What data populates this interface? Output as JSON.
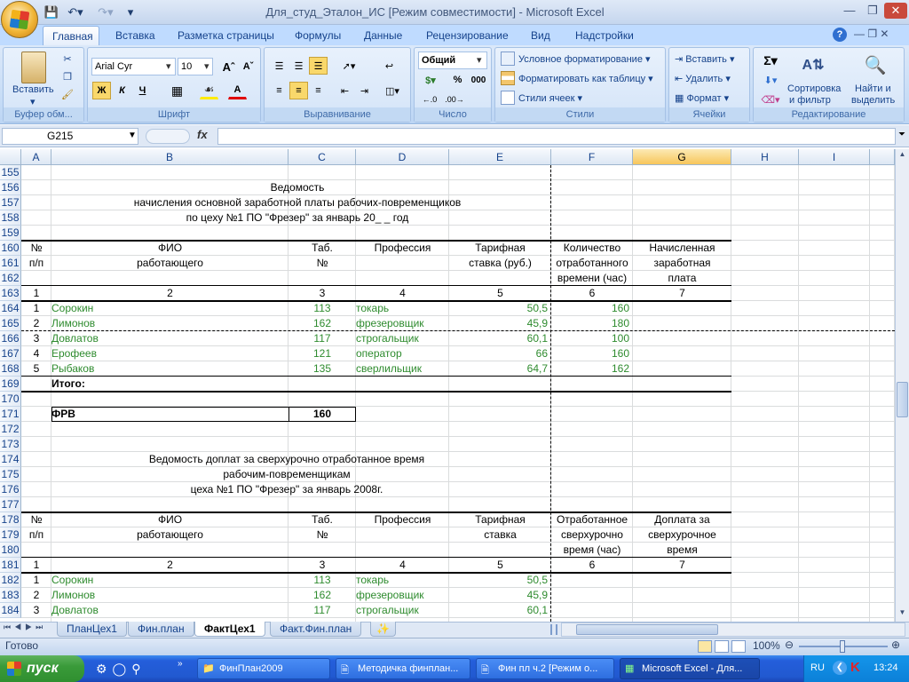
{
  "window_title": "Для_студ_Эталон_ИС  [Режим совместимости] - Microsoft Excel",
  "ribbon": {
    "tabs": [
      "Главная",
      "Вставка",
      "Разметка страницы",
      "Формулы",
      "Данные",
      "Рецензирование",
      "Вид",
      "Надстройки"
    ],
    "active_tab": "Главная",
    "groups": {
      "clipboard": {
        "label": "Буфер обм...",
        "paste": "Вставить"
      },
      "font": {
        "label": "Шрифт",
        "font_name": "Arial Cyr",
        "font_size": "10",
        "bold": "Ж",
        "italic": "К",
        "underline": "Ч"
      },
      "alignment": {
        "label": "Выравнивание"
      },
      "number": {
        "label": "Число",
        "format": "Общий",
        "percent": "%",
        "thousands": "000"
      },
      "styles": {
        "label": "Стили",
        "conditional": "Условное форматирование",
        "as_table": "Форматировать как таблицу",
        "cell_styles": "Стили ячеек"
      },
      "cells": {
        "label": "Ячейки",
        "insert": "Вставить",
        "delete": "Удалить",
        "format": "Формат"
      },
      "editing": {
        "label": "Редактирование",
        "sort": "Сортировка",
        "sort2": "и фильтр",
        "find": "Найти и",
        "find2": "выделить"
      }
    }
  },
  "formula_bar": {
    "name_box": "G215",
    "fx": "fx",
    "value": ""
  },
  "sheet": {
    "columns": [
      "A",
      "B",
      "C",
      "D",
      "E",
      "F",
      "G",
      "H",
      "I"
    ],
    "selected_column": "G",
    "rows": [
      "155",
      "156",
      "157",
      "158",
      "159",
      "160",
      "161",
      "162",
      "163",
      "164",
      "165",
      "166",
      "167",
      "168",
      "169",
      "170",
      "171",
      "172",
      "173",
      "174",
      "175",
      "176",
      "177",
      "178",
      "179",
      "180",
      "181",
      "182",
      "183",
      "184"
    ],
    "title1": [
      "Ведомость",
      "начисления основной заработной платы рабочих-повременщиков",
      "по цеху №1 ПО \"Фрезер\" за январь 20_ _  год"
    ],
    "headers1": {
      "num": [
        "№",
        "п/п"
      ],
      "fio": [
        "ФИО",
        "работающего"
      ],
      "tab": [
        "Таб.",
        "№"
      ],
      "prof": [
        "Профессия"
      ],
      "rate": [
        "Тарифная",
        "ставка (руб.)"
      ],
      "qty": [
        "Количество",
        "отработанного",
        "времени (час)"
      ],
      "pay": [
        "Начисленная",
        "заработная",
        "плата"
      ]
    },
    "colnums": [
      "1",
      "2",
      "3",
      "4",
      "5",
      "6",
      "7"
    ],
    "table1": [
      {
        "n": "1",
        "name": "Сорокин",
        "tab": "113",
        "prof": "токарь",
        "rate": "50,5",
        "hours": "160"
      },
      {
        "n": "2",
        "name": "Лимонов",
        "tab": "162",
        "prof": "фрезеровщик",
        "rate": "45,9",
        "hours": "180"
      },
      {
        "n": "3",
        "name": "Довлатов",
        "tab": "117",
        "prof": "строгальщик",
        "rate": "60,1",
        "hours": "100"
      },
      {
        "n": "4",
        "name": "Ерофеев",
        "tab": "121",
        "prof": "оператор",
        "rate": "66",
        "hours": "160"
      },
      {
        "n": "5",
        "name": "Рыбаков",
        "tab": "135",
        "prof": "сверлильщик",
        "rate": "64,7",
        "hours": "162"
      }
    ],
    "total_label": "Итого:",
    "frv_label": "ФРВ",
    "frv_value": "160",
    "title2": [
      "Ведомость доплат за сверхурочно отработанное время",
      "рабочим-повременщикам",
      "цеха №1 ПО \"Фрезер\" за январь 2008г."
    ],
    "headers2": {
      "num": [
        "№",
        "п/п"
      ],
      "fio": [
        "ФИО",
        "работающего"
      ],
      "tab": [
        "Таб.",
        "№"
      ],
      "prof": [
        "Профессия"
      ],
      "rate": [
        "Тарифная",
        "ставка"
      ],
      "over": [
        "Отработанное",
        "сверхурочно",
        "время (час)"
      ],
      "extra": [
        "Доплата за",
        "сверхурочное",
        "время"
      ]
    },
    "table2": [
      {
        "n": "1",
        "name": "Сорокин",
        "tab": "113",
        "prof": "токарь",
        "rate": "50,5"
      },
      {
        "n": "2",
        "name": "Лимонов",
        "tab": "162",
        "prof": "фрезеровщик",
        "rate": "45,9"
      },
      {
        "n": "3",
        "name": "Довлатов",
        "tab": "117",
        "prof": "строгальщик",
        "rate": "60,1"
      }
    ]
  },
  "sheet_tabs": [
    "ПланЦех1",
    "Фин.план",
    "ФактЦех1",
    "Факт.Фин.план"
  ],
  "active_sheet_tab": "ФактЦех1",
  "status": {
    "ready": "Готово",
    "zoom": "100%"
  },
  "taskbar": {
    "start": "пуск",
    "tasks": [
      "ФинПлан2009",
      "Методичка финплан...",
      "Фин пл ч.2 [Режим о...",
      "Microsoft Excel - Для..."
    ],
    "lang": "RU",
    "clock": "13:24"
  }
}
